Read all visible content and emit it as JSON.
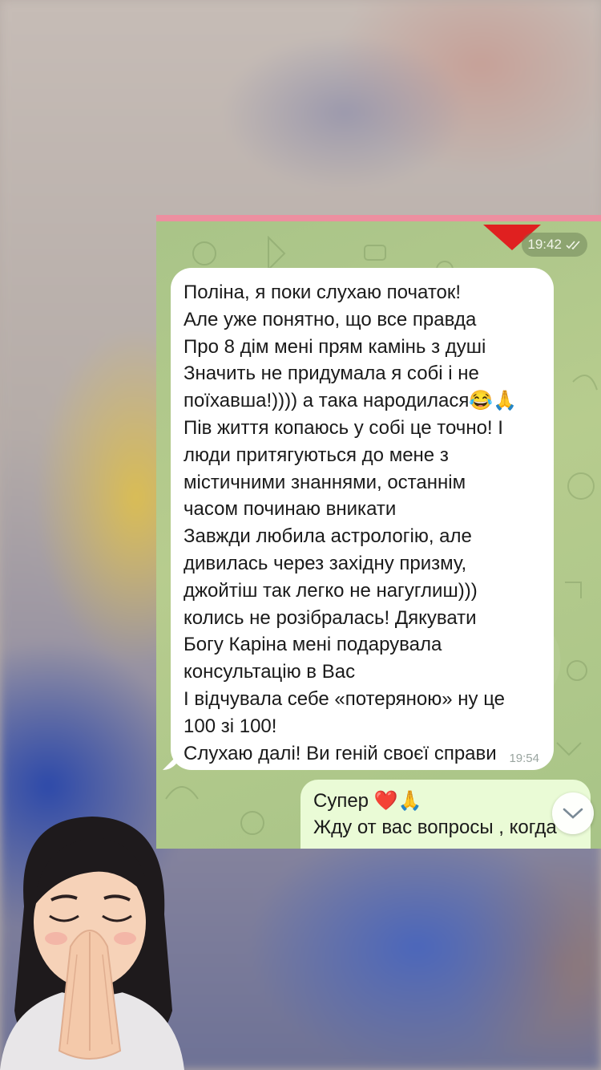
{
  "chat": {
    "header_time": "19:42",
    "incoming": {
      "lines": [
        "Поліна, я поки слухаю початок!",
        "Але уже понятно, що все правда",
        "Про 8 дім мені прям камінь з душі",
        "Значить не придумала я собі і не",
        "поїхавша!)))) а така народилася😂🙏",
        "Пів життя копаюсь у собі це точно! І",
        "люди притягуються до мене з",
        "містичними знаннями, останнім",
        "часом починаю вникати",
        "Завжди любила астрологію, але",
        "дивилась через західну призму,",
        "джойтіш так легко не нагуглиш)))",
        "колись не розібралась! Дякувати",
        "Богу Каріна мені подарувала",
        "консультацію в Вас",
        "І відчувала себе «потеряною» ну це",
        "100 зі 100!",
        "Слухаю далі! Ви геній своєї справи"
      ],
      "time": "19:54"
    },
    "outgoing": {
      "line1": "Супер ❤️🙏",
      "line2": "Жду от вас вопросы , когда"
    }
  },
  "colors": {
    "chat_bg": "#b0c98a",
    "bubble_in": "#ffffff",
    "bubble_out": "#eafbd6",
    "accent_red": "#e02020"
  },
  "icons": {
    "read_receipt": "double-check-icon",
    "scroll": "chevron-down-icon",
    "sticker": "praying-memoji"
  }
}
